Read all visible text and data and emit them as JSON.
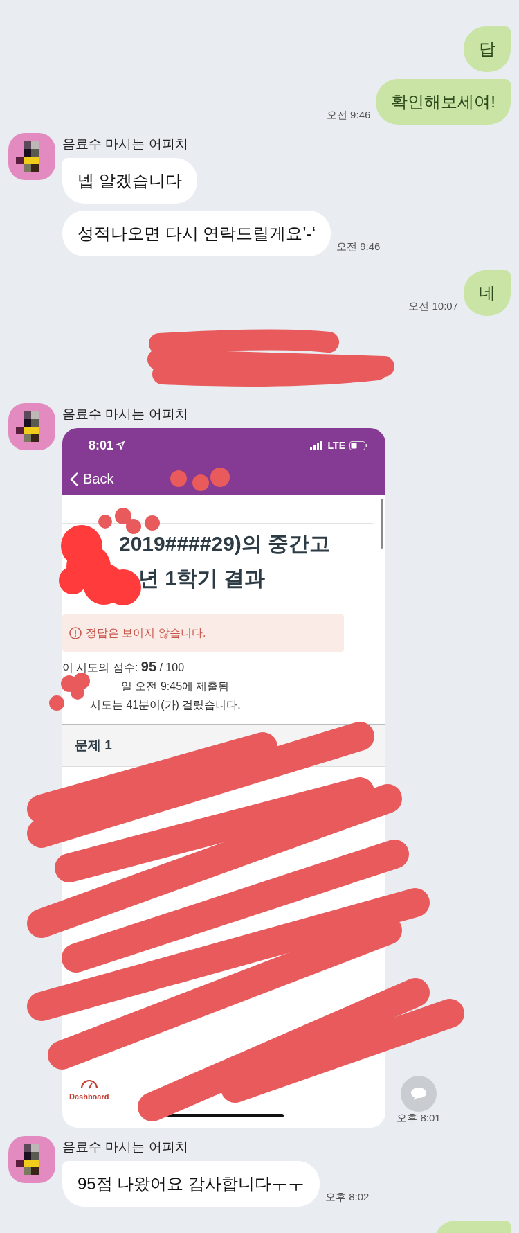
{
  "messages": [
    {
      "kind": "sent",
      "text": "답"
    },
    {
      "kind": "sent",
      "text": "확인해보세여!",
      "time": "오전 9:46"
    },
    {
      "kind": "received",
      "sender": "음료수 마시는 어피치",
      "text": "넵 알겠습니다"
    },
    {
      "kind": "received",
      "text": "성적나오면 다시 연락드릴게요’-‘",
      "time": "오전 9:46"
    },
    {
      "kind": "sent",
      "text": "네",
      "time": "오전 10:07"
    },
    {
      "kind": "redacted"
    },
    {
      "kind": "image",
      "sender": "음료수 마시는 어피치",
      "time": "오후 8:01",
      "screenshot": {
        "status_time": "8:01",
        "network": "LTE",
        "back": "Back",
        "title_lines": [
          "2019####29)의 중간고",
          "년 1학기 결과"
        ],
        "notice": "정답은 보이지 않습니다.",
        "details": [
          "이 시도의 점수: **95** / 100",
          "일 오전 9:45에 제출됨",
          "시도는 41분이(가) 걸렸습니다."
        ],
        "question": "문제 1",
        "tab": "Dashboard"
      }
    },
    {
      "kind": "received",
      "sender": "음료수 마시는 어피치",
      "text": "95점 나왔어요 감사합니다ㅜㅜ",
      "time": "오후 8:02"
    },
    {
      "kind": "partial"
    }
  ]
}
